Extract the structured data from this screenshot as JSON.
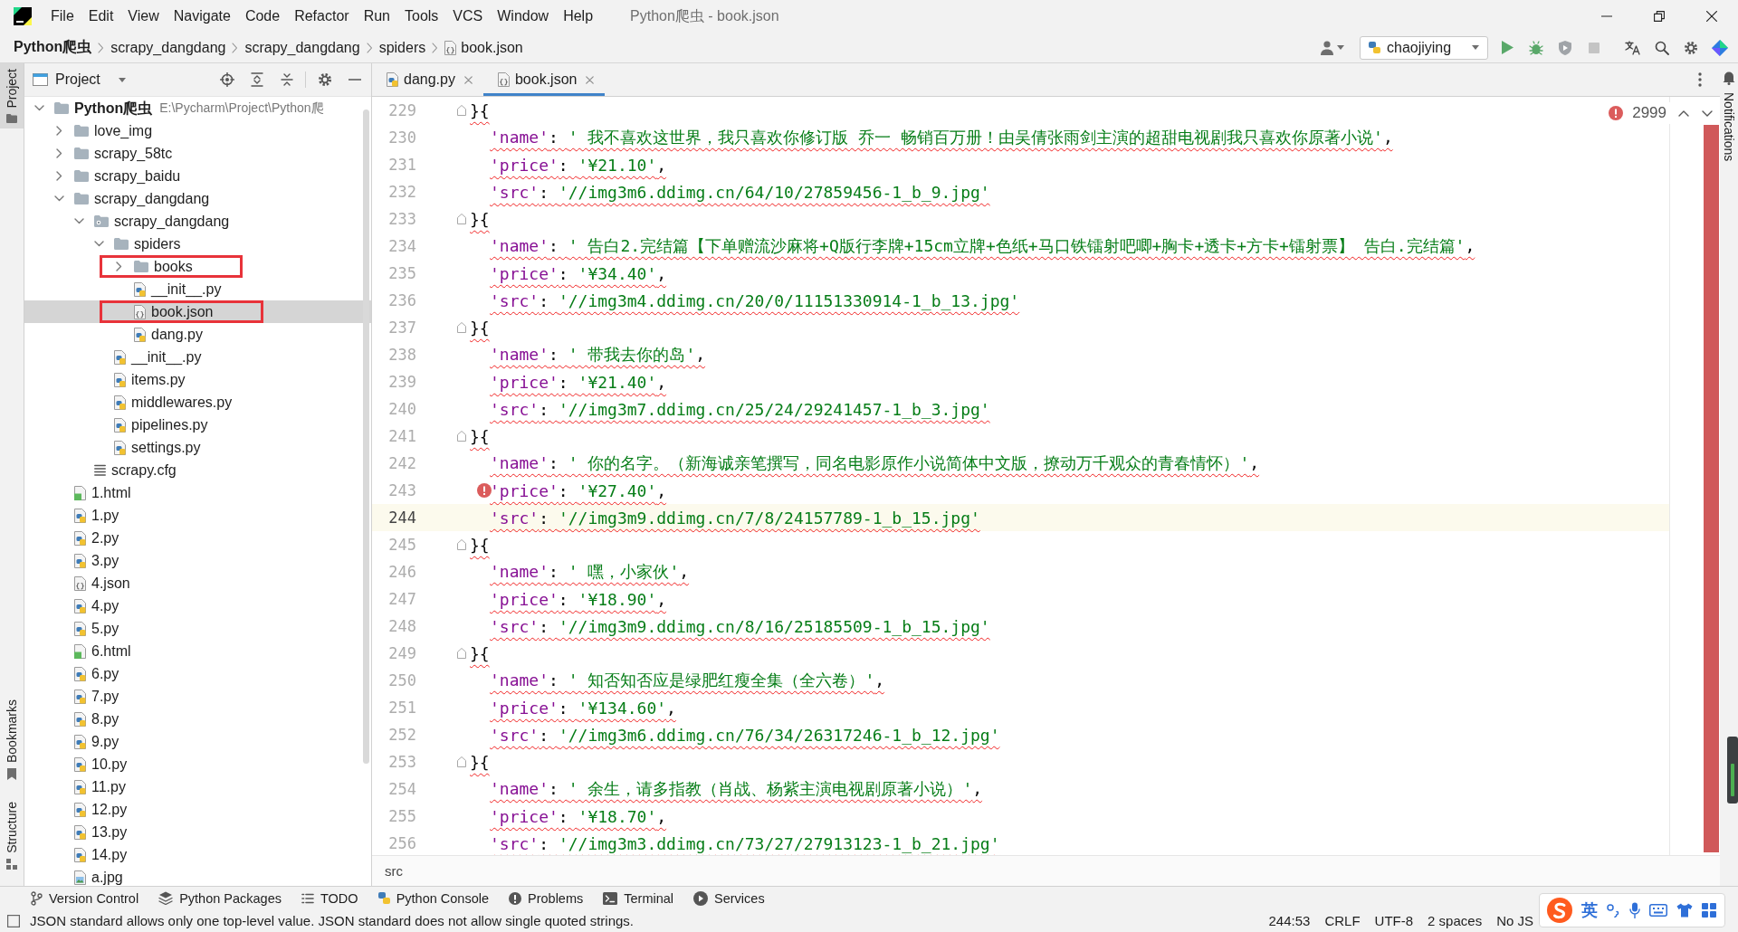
{
  "title_bar": {
    "menu": [
      "File",
      "Edit",
      "View",
      "Navigate",
      "Code",
      "Refactor",
      "Run",
      "Tools",
      "VCS",
      "Window",
      "Help"
    ],
    "title": "Python爬虫 - book.json"
  },
  "nav_bar": {
    "breadcrumbs": [
      {
        "label": "Python爬虫",
        "kind": "project"
      },
      {
        "label": "scrapy_dangdang",
        "kind": "folder"
      },
      {
        "label": "scrapy_dangdang",
        "kind": "folder"
      },
      {
        "label": "spiders",
        "kind": "folder"
      },
      {
        "label": "book.json",
        "kind": "json"
      }
    ],
    "run_config": "chaojiying"
  },
  "tool_strip_left": {
    "top": [
      {
        "label": "Project",
        "kind": "project",
        "selected": true
      }
    ],
    "bottom": [
      {
        "label": "Bookmarks",
        "kind": "bookmarks",
        "selected": false
      },
      {
        "label": "Structure",
        "kind": "structure",
        "selected": false
      }
    ]
  },
  "project_panel": {
    "title": "Project",
    "tree": [
      {
        "label": "Python爬虫",
        "path": "E:\\Pycharm\\Project\\Python爬",
        "kind": "project",
        "expanded": true,
        "selected": false,
        "highlighted": false,
        "children": [
          {
            "label": "love_img",
            "kind": "folder",
            "expanded": false,
            "selected": false,
            "highlighted": false
          },
          {
            "label": "scrapy_58tc",
            "kind": "folder",
            "expanded": false,
            "selected": false,
            "highlighted": false
          },
          {
            "label": "scrapy_baidu",
            "kind": "folder",
            "expanded": false,
            "selected": false,
            "highlighted": false
          },
          {
            "label": "scrapy_dangdang",
            "kind": "folder",
            "expanded": true,
            "selected": false,
            "highlighted": false,
            "children": [
              {
                "label": "scrapy_dangdang",
                "kind": "package",
                "expanded": true,
                "selected": false,
                "highlighted": false,
                "children": [
                  {
                    "label": "spiders",
                    "kind": "folder",
                    "expanded": true,
                    "selected": false,
                    "highlighted": false,
                    "children": [
                      {
                        "label": "books",
                        "kind": "folder",
                        "expanded": false,
                        "selected": false,
                        "highlighted": true
                      },
                      {
                        "label": "__init__.py",
                        "kind": "python",
                        "selected": false,
                        "highlighted": false
                      },
                      {
                        "label": "book.json",
                        "kind": "json",
                        "selected": true,
                        "highlighted": true
                      },
                      {
                        "label": "dang.py",
                        "kind": "python",
                        "selected": false,
                        "highlighted": false
                      }
                    ]
                  },
                  {
                    "label": "__init__.py",
                    "kind": "python",
                    "selected": false,
                    "highlighted": false
                  },
                  {
                    "label": "items.py",
                    "kind": "python",
                    "selected": false,
                    "highlighted": false
                  },
                  {
                    "label": "middlewares.py",
                    "kind": "python",
                    "selected": false,
                    "highlighted": false
                  },
                  {
                    "label": "pipelines.py",
                    "kind": "python",
                    "selected": false,
                    "highlighted": false
                  },
                  {
                    "label": "settings.py",
                    "kind": "python",
                    "selected": false,
                    "highlighted": false
                  }
                ]
              },
              {
                "label": "scrapy.cfg",
                "kind": "config",
                "selected": false,
                "highlighted": false
              }
            ]
          },
          {
            "label": "1.html",
            "kind": "html",
            "selected": false,
            "highlighted": false
          },
          {
            "label": "1.py",
            "kind": "python",
            "selected": false,
            "highlighted": false
          },
          {
            "label": "2.py",
            "kind": "python",
            "selected": false,
            "highlighted": false
          },
          {
            "label": "3.py",
            "kind": "python",
            "selected": false,
            "highlighted": false
          },
          {
            "label": "4.json",
            "kind": "json",
            "selected": false,
            "highlighted": false
          },
          {
            "label": "4.py",
            "kind": "python",
            "selected": false,
            "highlighted": false
          },
          {
            "label": "5.py",
            "kind": "python",
            "selected": false,
            "highlighted": false
          },
          {
            "label": "6.html",
            "kind": "html",
            "selected": false,
            "highlighted": false
          },
          {
            "label": "6.py",
            "kind": "python",
            "selected": false,
            "highlighted": false
          },
          {
            "label": "7.py",
            "kind": "python",
            "selected": false,
            "highlighted": false
          },
          {
            "label": "8.py",
            "kind": "python",
            "selected": false,
            "highlighted": false
          },
          {
            "label": "9.py",
            "kind": "python",
            "selected": false,
            "highlighted": false
          },
          {
            "label": "10.py",
            "kind": "python",
            "selected": false,
            "highlighted": false
          },
          {
            "label": "11.py",
            "kind": "python",
            "selected": false,
            "highlighted": false
          },
          {
            "label": "12.py",
            "kind": "python",
            "selected": false,
            "highlighted": false
          },
          {
            "label": "13.py",
            "kind": "python",
            "selected": false,
            "highlighted": false
          },
          {
            "label": "14.py",
            "kind": "python",
            "selected": false,
            "highlighted": false
          },
          {
            "label": "a.jpg",
            "kind": "image",
            "selected": false,
            "highlighted": false
          }
        ]
      }
    ]
  },
  "editor": {
    "tabs": [
      {
        "label": "dang.py",
        "kind": "python",
        "selected": false
      },
      {
        "label": "book.json",
        "kind": "json",
        "selected": true
      }
    ],
    "problems": "2999",
    "lines": [
      {
        "number": "229",
        "kind": "brace",
        "text": "}{",
        "current": false,
        "error": false
      },
      {
        "number": "230",
        "kind": "pair",
        "key": "'name'",
        "sep": ": ",
        "value": "' 我不喜欢这世界，我只喜欢你修订版 乔一 畅销百万册！由吴倩张雨剑主演的超甜电视剧我只喜欢你原著小说'",
        "end": ",",
        "current": false,
        "error": false
      },
      {
        "number": "231",
        "kind": "pair",
        "key": "'price'",
        "sep": ": ",
        "value": "'¥21.10'",
        "end": ",",
        "current": false,
        "error": false
      },
      {
        "number": "232",
        "kind": "pair",
        "key": "'src'",
        "sep": ": ",
        "value": "'//img3m6.ddimg.cn/64/10/27859456-1_b_9.jpg'",
        "current": false,
        "error": false
      },
      {
        "number": "233",
        "kind": "brace",
        "text": "}{",
        "current": false,
        "error": false
      },
      {
        "number": "234",
        "kind": "pair",
        "key": "'name'",
        "sep": ": ",
        "value": "' 告白2.完结篇【下单赠流沙麻将+Q版行李牌+15cm立牌+色纸+马口铁镭射吧唧+胸卡+透卡+方卡+镭射票】 告白.完结篇'",
        "end": ",",
        "current": false,
        "error": false
      },
      {
        "number": "235",
        "kind": "pair",
        "key": "'price'",
        "sep": ": ",
        "value": "'¥34.40'",
        "end": ",",
        "current": false,
        "error": false
      },
      {
        "number": "236",
        "kind": "pair",
        "key": "'src'",
        "sep": ": ",
        "value": "'//img3m4.ddimg.cn/20/0/11151330914-1_b_13.jpg'",
        "current": false,
        "error": false
      },
      {
        "number": "237",
        "kind": "brace",
        "text": "}{",
        "current": false,
        "error": false
      },
      {
        "number": "238",
        "kind": "pair",
        "key": "'name'",
        "sep": ": ",
        "value": "' 带我去你的岛'",
        "end": ",",
        "current": false,
        "error": false
      },
      {
        "number": "239",
        "kind": "pair",
        "key": "'price'",
        "sep": ": ",
        "value": "'¥21.40'",
        "end": ",",
        "current": false,
        "error": false
      },
      {
        "number": "240",
        "kind": "pair",
        "key": "'src'",
        "sep": ": ",
        "value": "'//img3m7.ddimg.cn/25/24/29241457-1_b_3.jpg'",
        "current": false,
        "error": false
      },
      {
        "number": "241",
        "kind": "brace",
        "text": "}{",
        "current": false,
        "error": false
      },
      {
        "number": "242",
        "kind": "pair",
        "key": "'name'",
        "sep": ": ",
        "value": "' 你的名字。（新海诚亲笔撰写，同名电影原作小说简体中文版，撩动万千观众的青春情怀）'",
        "end": ",",
        "current": false,
        "error": false
      },
      {
        "number": "243",
        "kind": "pair",
        "key": "'price'",
        "sep": ": ",
        "value": "'¥27.40'",
        "end": ",",
        "current": false,
        "error": true
      },
      {
        "number": "244",
        "kind": "pair",
        "key": "'src'",
        "sep": ": ",
        "value": "'//img3m9.ddimg.cn/7/8/24157789-1_b_15.jpg'",
        "current": true,
        "error": false
      },
      {
        "number": "245",
        "kind": "brace",
        "text": "}{",
        "current": false,
        "error": false
      },
      {
        "number": "246",
        "kind": "pair",
        "key": "'name'",
        "sep": ": ",
        "value": "' 嘿，小家伙'",
        "end": ",",
        "current": false,
        "error": false
      },
      {
        "number": "247",
        "kind": "pair",
        "key": "'price'",
        "sep": ": ",
        "value": "'¥18.90'",
        "end": ",",
        "current": false,
        "error": false
      },
      {
        "number": "248",
        "kind": "pair",
        "key": "'src'",
        "sep": ": ",
        "value": "'//img3m9.ddimg.cn/8/16/25185509-1_b_15.jpg'",
        "current": false,
        "error": false
      },
      {
        "number": "249",
        "kind": "brace",
        "text": "}{",
        "current": false,
        "error": false
      },
      {
        "number": "250",
        "kind": "pair",
        "key": "'name'",
        "sep": ": ",
        "value": "' 知否知否应是绿肥红瘦全集（全六卷）'",
        "end": ",",
        "current": false,
        "error": false
      },
      {
        "number": "251",
        "kind": "pair",
        "key": "'price'",
        "sep": ": ",
        "value": "'¥134.60'",
        "end": ",",
        "current": false,
        "error": false
      },
      {
        "number": "252",
        "kind": "pair",
        "key": "'src'",
        "sep": ": ",
        "value": "'//img3m6.ddimg.cn/76/34/26317246-1_b_12.jpg'",
        "current": false,
        "error": false
      },
      {
        "number": "253",
        "kind": "brace",
        "text": "}{",
        "current": false,
        "error": false
      },
      {
        "number": "254",
        "kind": "pair",
        "key": "'name'",
        "sep": ": ",
        "value": "' 余生，请多指教（肖战、杨紫主演电视剧原著小说）'",
        "end": ",",
        "current": false,
        "error": false
      },
      {
        "number": "255",
        "kind": "pair",
        "key": "'price'",
        "sep": ": ",
        "value": "'¥18.70'",
        "end": ",",
        "current": false,
        "error": false
      },
      {
        "number": "256",
        "kind": "pair",
        "key": "'src'",
        "sep": ": ",
        "value": "'//img3m3.ddimg.cn/73/27/27913123-1_b_21.jpg'",
        "current": false,
        "error": false
      }
    ],
    "breadcrumb": "src"
  },
  "tool_strip_right": {
    "label": "Notifications"
  },
  "tool_windows": [
    {
      "label": "Version Control",
      "kind": "vcs"
    },
    {
      "label": "Python Packages",
      "kind": "packages"
    },
    {
      "label": "TODO",
      "kind": "todo"
    },
    {
      "label": "Python Console",
      "kind": "console"
    },
    {
      "label": "Problems",
      "kind": "problems"
    },
    {
      "label": "Terminal",
      "kind": "terminal"
    },
    {
      "label": "Services",
      "kind": "services"
    }
  ],
  "status_bar": {
    "message": "JSON standard allows only one top-level value. JSON standard does not allow single quoted strings.",
    "items": [
      "244:53",
      "CRLF",
      "UTF-8",
      "2 spaces",
      "No JS"
    ]
  },
  "input_method": {
    "mode": "英"
  }
}
